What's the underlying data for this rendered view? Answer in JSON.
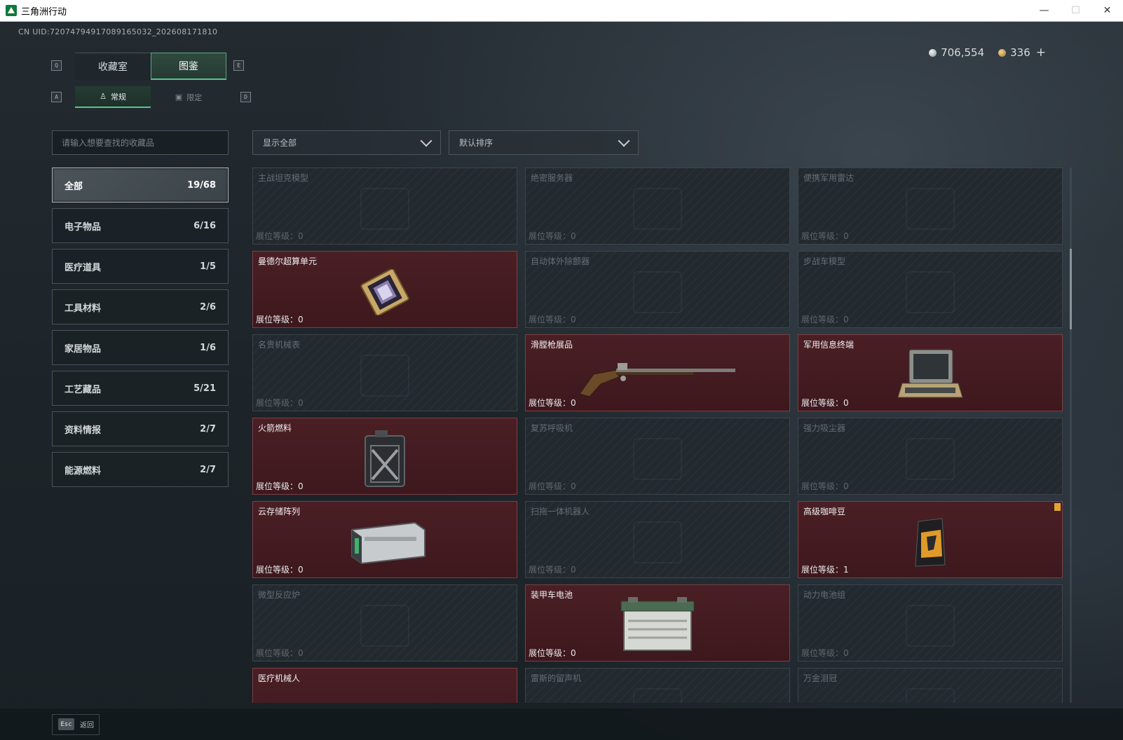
{
  "window": {
    "title": "三角洲行动",
    "minimize": "—",
    "maximize": "☐",
    "close": "✕"
  },
  "header": {
    "uid": "CN UID:720747949170891650​32_202608171810",
    "silver": "706,554",
    "gold": "336",
    "plus": "+"
  },
  "keys": {
    "q": "Q",
    "e": "E",
    "a": "A",
    "d": "D"
  },
  "tabs": [
    {
      "label": "收藏室"
    },
    {
      "label": "图鉴"
    }
  ],
  "subtabs": [
    {
      "label": "常规",
      "icon": "cone-icon"
    },
    {
      "label": "限定",
      "icon": "frame-icon"
    }
  ],
  "search": {
    "placeholder": "请输入想要查找的收藏品",
    "value": ""
  },
  "filters": {
    "show": "显示全部",
    "sort": "默认排序"
  },
  "categories": [
    {
      "label": "全部",
      "count": "19/68",
      "active": true
    },
    {
      "label": "电子物品",
      "count": "6/16"
    },
    {
      "label": "医疗道具",
      "count": "1/5"
    },
    {
      "label": "工具材料",
      "count": "2/6"
    },
    {
      "label": "家居物品",
      "count": "1/6"
    },
    {
      "label": "工艺藏品",
      "count": "5/21"
    },
    {
      "label": "资料情报",
      "count": "2/7"
    },
    {
      "label": "能源燃料",
      "count": "2/7"
    }
  ],
  "level_label": "展位等级：",
  "items": [
    {
      "name": "主战坦克模型",
      "level": "0",
      "owned": false,
      "icon": "tank-icon"
    },
    {
      "name": "绝密服务器",
      "level": "0",
      "owned": false,
      "icon": "server-icon"
    },
    {
      "name": "便携军用雷达",
      "level": "0",
      "owned": false,
      "icon": "radar-icon"
    },
    {
      "name": "曼德尔超算单元",
      "level": "0",
      "owned": true,
      "icon": "chip-icon"
    },
    {
      "name": "自动体外除颤器",
      "level": "0",
      "owned": false,
      "icon": "defibrillator-icon"
    },
    {
      "name": "步战车模型",
      "level": "0",
      "owned": false,
      "icon": "ifv-icon"
    },
    {
      "name": "名贵机械表",
      "level": "0",
      "owned": false,
      "icon": "watch-icon"
    },
    {
      "name": "滑膛枪展品",
      "level": "0",
      "owned": true,
      "icon": "musket-icon"
    },
    {
      "name": "军用信息终端",
      "level": "0",
      "owned": true,
      "icon": "terminal-icon"
    },
    {
      "name": "火箭燃料",
      "level": "0",
      "owned": true,
      "icon": "fuel-can-icon"
    },
    {
      "name": "复苏呼吸机",
      "level": "0",
      "owned": false,
      "icon": "ventilator-icon"
    },
    {
      "name": "强力吸尘器",
      "level": "0",
      "owned": false,
      "icon": "vacuum-icon"
    },
    {
      "name": "云存储阵列",
      "level": "0",
      "owned": true,
      "icon": "storage-array-icon"
    },
    {
      "name": "扫拖一体机器人",
      "level": "0",
      "owned": false,
      "icon": "robot-vacuum-icon"
    },
    {
      "name": "高级咖啡豆",
      "level": "1",
      "owned": true,
      "icon": "coffee-bag-icon",
      "badge": true
    },
    {
      "name": "微型反应炉",
      "level": "0",
      "owned": false,
      "icon": "reactor-icon"
    },
    {
      "name": "装甲车电池",
      "level": "0",
      "owned": true,
      "icon": "battery-icon"
    },
    {
      "name": "动力电池组",
      "level": "0",
      "owned": false,
      "icon": "battery-pack-icon"
    },
    {
      "name": "医疗机械人",
      "level": "",
      "owned": true,
      "icon": "medical-robot-icon"
    },
    {
      "name": "雷斯的留声机",
      "level": "",
      "owned": false,
      "icon": "gramophone-icon"
    },
    {
      "name": "万金泪冠",
      "level": "",
      "owned": false,
      "icon": "crown-icon"
    }
  ],
  "footer": {
    "key": "Esc",
    "label": "返回"
  }
}
